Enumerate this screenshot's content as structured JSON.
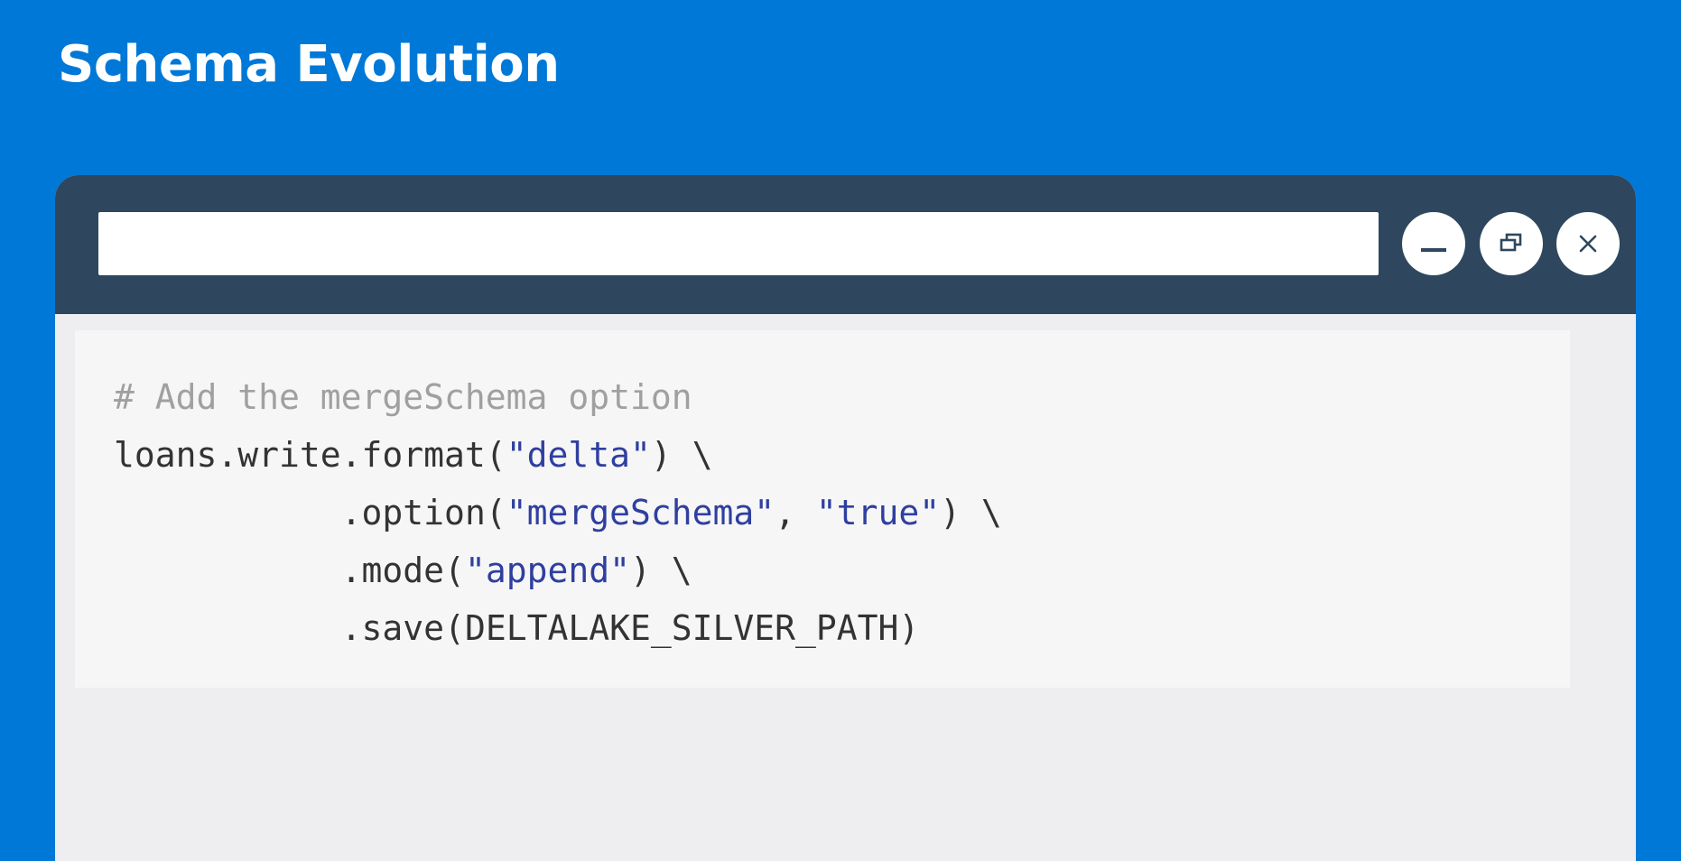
{
  "slide": {
    "title": "Schema Evolution"
  },
  "window": {
    "address_value": "",
    "buttons": {
      "minimize_icon": "minimize-icon",
      "restore_icon": "restore-icon",
      "close_icon": "close-icon"
    }
  },
  "code": {
    "line1": {
      "comment": "# Add the mergeSchema option"
    },
    "line2": {
      "pre": "loans.write.format(",
      "str1": "\"delta\"",
      "post": ") \\"
    },
    "line3": {
      "indent": "           ",
      "pre": ".option(",
      "str1": "\"mergeSchema\"",
      "mid": ", ",
      "str2": "\"true\"",
      "post": ") \\"
    },
    "line4": {
      "indent": "           ",
      "pre": ".mode(",
      "str1": "\"append\"",
      "post": ") \\"
    },
    "line5": {
      "indent": "           ",
      "text": ".save(DELTALAKE_SILVER_PATH)"
    }
  },
  "colors": {
    "background": "#0078d7",
    "titlebar": "#2e475e",
    "content": "#eeeef0",
    "string": "#2f3f9f",
    "comment": "#a0a0a0"
  }
}
